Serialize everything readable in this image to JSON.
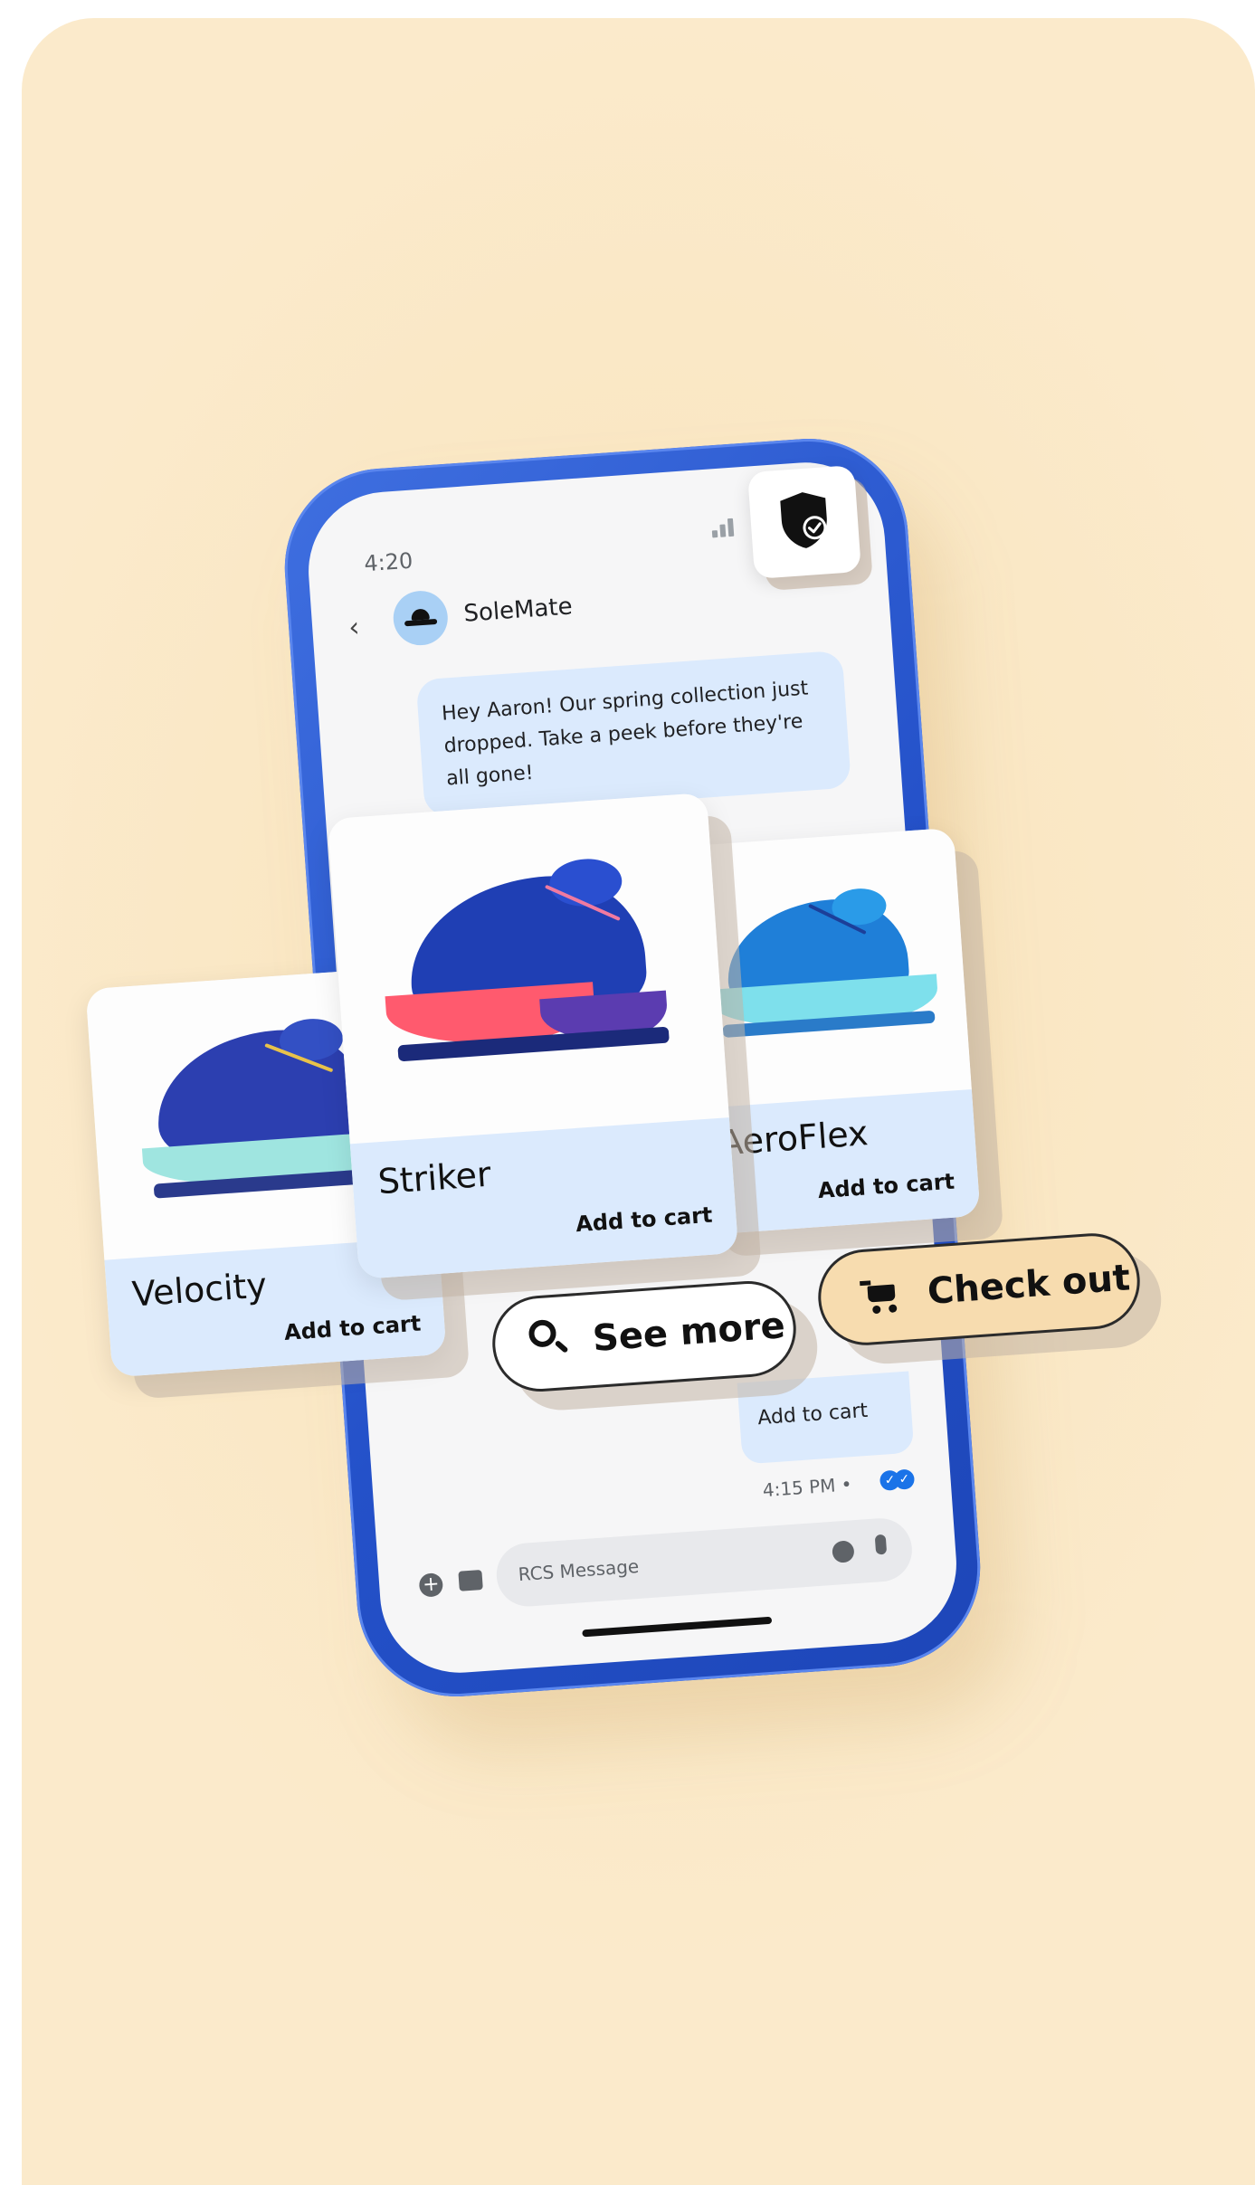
{
  "status_bar": {
    "time": "4:20"
  },
  "header": {
    "contact_name": "SoleMate"
  },
  "message": {
    "text": "Hey Aaron! Our spring collection just dropped. Take a peek before they're all gone!"
  },
  "products": [
    {
      "name": "Velocity",
      "cta": "Add to cart"
    },
    {
      "name": "Striker",
      "cta": "Add to cart"
    },
    {
      "name": "AeroFlex",
      "cta": "Add to cart"
    }
  ],
  "partial_card": {
    "cta": "Add to cart"
  },
  "message_meta": {
    "timestamp": "4:15 PM •"
  },
  "actions": {
    "see_more": "See more",
    "check_out": "Check out"
  },
  "composer": {
    "placeholder": "RCS Message"
  },
  "colors": {
    "background": "#fae7c4",
    "phone_frame": "#2451c9",
    "bubble": "#dbeafd",
    "checkout_pill": "#f7dcaf"
  },
  "icons": [
    "back-icon",
    "signal-icon",
    "shield-check-icon",
    "search-icon",
    "cart-icon",
    "read-receipt-icon",
    "plus-icon",
    "image-icon",
    "emoji-icon",
    "mic-icon"
  ]
}
